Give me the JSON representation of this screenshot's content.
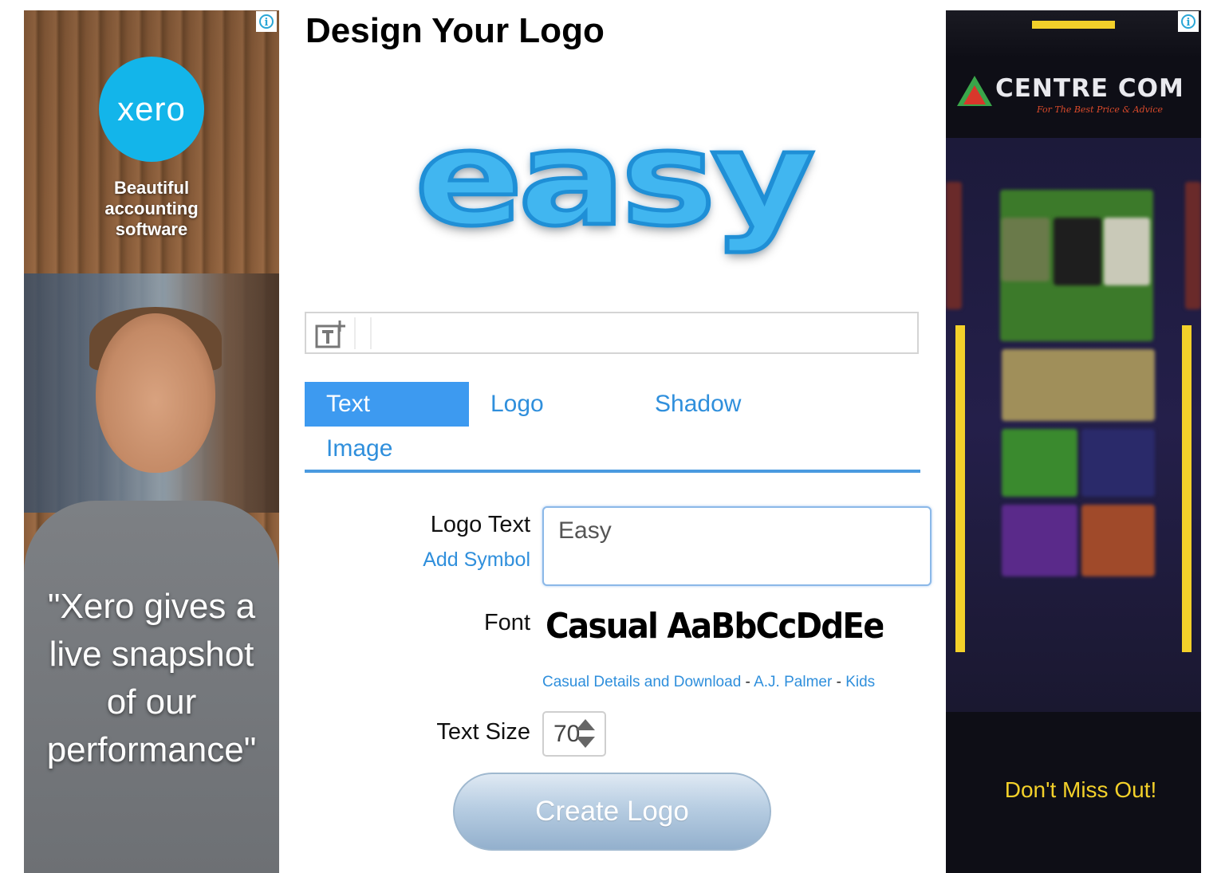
{
  "page": {
    "title": "Design Your Logo"
  },
  "preview": {
    "text": "easy"
  },
  "tabs": [
    {
      "label": "Text",
      "active": true
    },
    {
      "label": "Logo",
      "active": false
    },
    {
      "label": "Shadow",
      "active": false
    },
    {
      "label": "Image",
      "active": false
    }
  ],
  "form": {
    "logo_text_label": "Logo Text",
    "add_symbol_link": "Add Symbol",
    "logo_text_value": "Easy",
    "font_label": "Font",
    "font_sample": "Casual AaBbCcDdEeFfGgHhI",
    "font_links": {
      "details": "Casual Details and Download",
      "sep1": " - ",
      "author": "A.J. Palmer",
      "sep2": " - ",
      "category": "Kids"
    },
    "text_size_label": "Text Size",
    "text_size_value": "70",
    "create_button": "Create Logo"
  },
  "ad_left": {
    "brand": "xero",
    "tagline": "Beautiful accounting software",
    "quote": "\"Xero gives a live snapshot of our performance\"",
    "info_icon": "info-icon"
  },
  "ad_right": {
    "brand": "CENTRE COM",
    "sub": "For The Best Price & Advice",
    "cta": "Don't Miss Out!",
    "info_icon": "info-icon"
  },
  "colors": {
    "accent": "#3d9af0",
    "link": "#2f8fdc",
    "xero": "#13b5ea",
    "centrecom_yellow": "#f3d02a"
  }
}
